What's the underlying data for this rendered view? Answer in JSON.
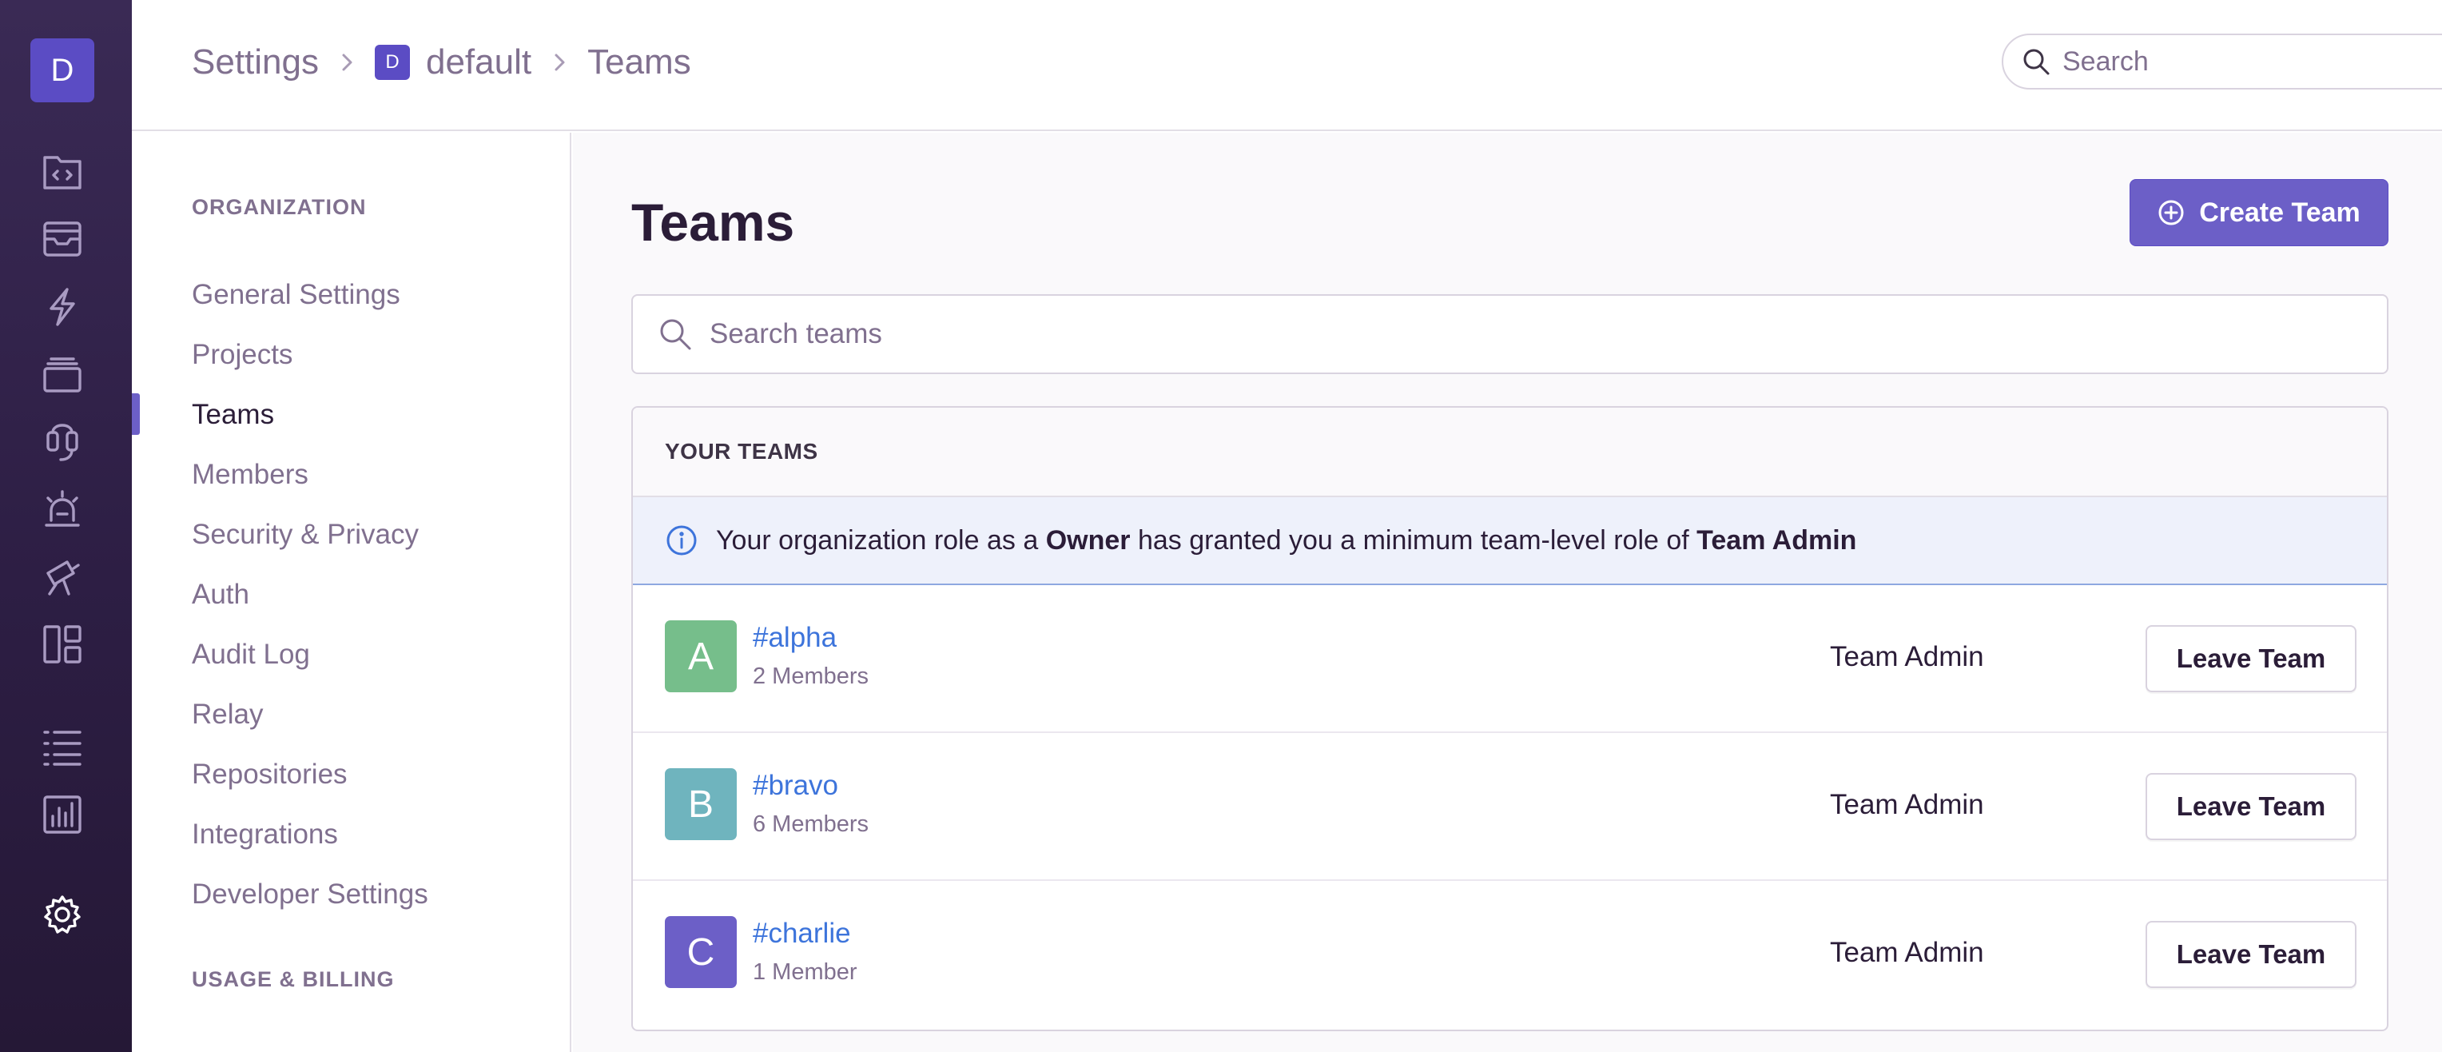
{
  "org": {
    "initial": "D",
    "color": "#5b4cc4"
  },
  "rail": {
    "icons": [
      "issues-icon",
      "projects-icon",
      "performance-icon",
      "releases-icon",
      "user-feedback-icon",
      "alerts-icon",
      "discover-icon",
      "dashboards-icon",
      "activity-icon",
      "stats-icon",
      "settings-icon"
    ]
  },
  "breadcrumb": {
    "settings": "Settings",
    "org_initial": "D",
    "org_name": "default",
    "current": "Teams"
  },
  "top_search": {
    "placeholder": "Search"
  },
  "nav": {
    "org_heading": "ORGANIZATION",
    "items": [
      "General Settings",
      "Projects",
      "Teams",
      "Members",
      "Security & Privacy",
      "Auth",
      "Audit Log",
      "Relay",
      "Repositories",
      "Integrations",
      "Developer Settings"
    ],
    "active_item": "Teams",
    "billing_heading": "USAGE & BILLING"
  },
  "main": {
    "title": "Teams",
    "create_button": "Create Team",
    "search_placeholder": "Search teams",
    "panel_header": "YOUR TEAMS",
    "alert": {
      "prefix": "Your organization role as a ",
      "role": "Owner",
      "middle": " has granted you a minimum team-level role of ",
      "team_role": "Team Admin"
    },
    "teams": [
      {
        "initial": "A",
        "name": "#alpha",
        "members": "2 Members",
        "role": "Team Admin",
        "action": "Leave Team",
        "color": "#76be8b"
      },
      {
        "initial": "B",
        "name": "#bravo",
        "members": "6 Members",
        "role": "Team Admin",
        "action": "Leave Team",
        "color": "#6fb4be"
      },
      {
        "initial": "C",
        "name": "#charlie",
        "members": "1 Member",
        "role": "Team Admin",
        "action": "Leave Team",
        "color": "#6c5fc7"
      }
    ]
  },
  "colors": {
    "accent": "#6c5fc7",
    "link": "#3d74db",
    "rail_bg": "#2d1e44",
    "muted_text": "#80708f"
  }
}
